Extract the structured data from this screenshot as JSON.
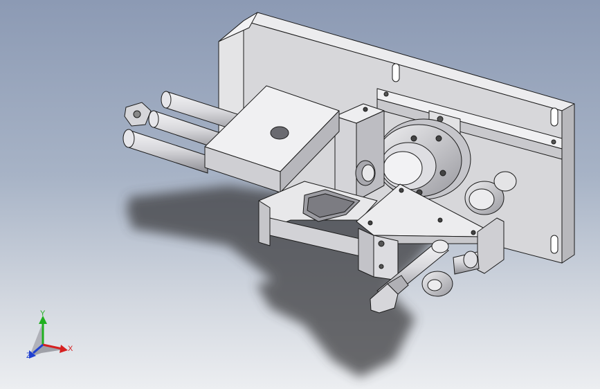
{
  "viewport": {
    "background_top": "#8c9ab4",
    "background_bottom": "#eceef1",
    "model_color": "#d9d9dc",
    "edge_color": "#1a1a1a",
    "shadow_color": "#3c3c40"
  },
  "triad": {
    "x_label": "X",
    "y_label": "Y",
    "z_label": "Z",
    "x_color": "#d62020",
    "y_color": "#20b020",
    "z_color": "#2040d0"
  },
  "icons": {
    "axis_triad": "reference-triad-icon"
  }
}
